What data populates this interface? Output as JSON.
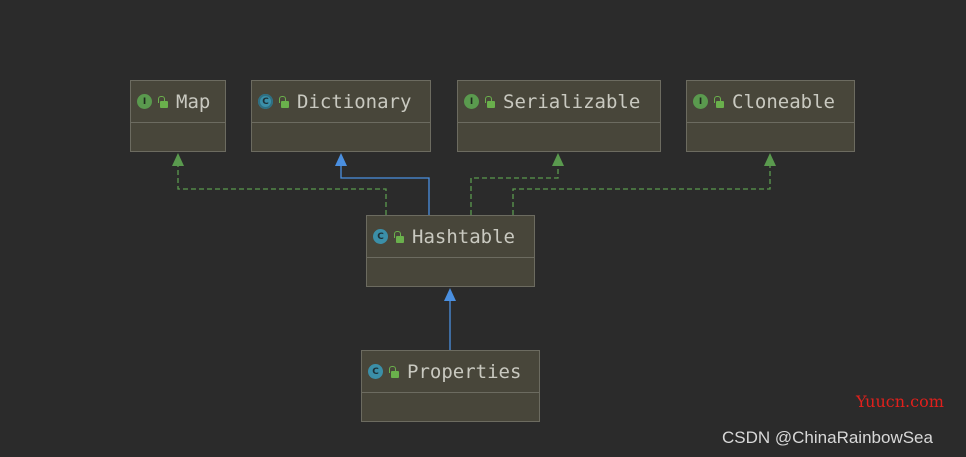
{
  "colors": {
    "background": "#2b2b2b",
    "node_fill": "#48463a",
    "node_border": "#6c6b60",
    "implements_edge": "#5a9a4e",
    "extends_edge": "#4a8fe0",
    "interface_badge": "#5a9a4e",
    "class_badge": "#3b8fa8"
  },
  "nodes": {
    "map": {
      "name": "Map",
      "badge": "I",
      "kind": "interface"
    },
    "dictionary": {
      "name": "Dictionary",
      "badge": "C",
      "kind": "abstract-class"
    },
    "serializable": {
      "name": "Serializable",
      "badge": "I",
      "kind": "interface"
    },
    "cloneable": {
      "name": "Cloneable",
      "badge": "I",
      "kind": "interface"
    },
    "hashtable": {
      "name": "Hashtable",
      "badge": "C",
      "kind": "class"
    },
    "properties": {
      "name": "Properties",
      "badge": "C",
      "kind": "class"
    }
  },
  "edges": [
    {
      "from": "Hashtable",
      "to": "Map",
      "type": "implements"
    },
    {
      "from": "Hashtable",
      "to": "Dictionary",
      "type": "extends"
    },
    {
      "from": "Hashtable",
      "to": "Serializable",
      "type": "implements"
    },
    {
      "from": "Hashtable",
      "to": "Cloneable",
      "type": "implements"
    },
    {
      "from": "Properties",
      "to": "Hashtable",
      "type": "extends"
    }
  ],
  "watermarks": {
    "site": "Yuucn.com",
    "author": "CSDN @ChinaRainbowSea"
  }
}
